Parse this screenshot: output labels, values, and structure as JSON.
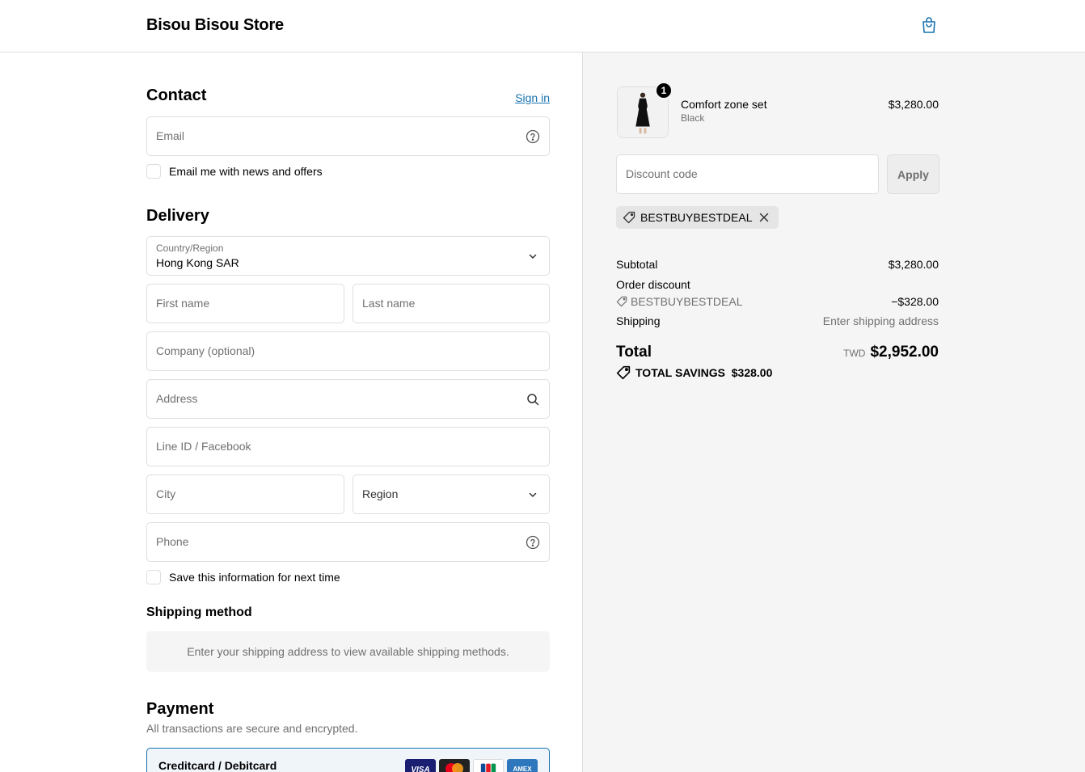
{
  "header": {
    "store_name": "Bisou Bisou Store",
    "cart_icon": "shopping-bag-icon"
  },
  "contact": {
    "title": "Contact",
    "sign_in": "Sign in",
    "email_placeholder": "Email",
    "news_checkbox": "Email me with news and offers"
  },
  "delivery": {
    "title": "Delivery",
    "country_label": "Country/Region",
    "country_value": "Hong Kong SAR",
    "first_name": "First name",
    "last_name": "Last name",
    "company": "Company (optional)",
    "address": "Address",
    "line_id": "Line ID / Facebook",
    "city": "City",
    "region": "Region",
    "phone": "Phone",
    "save_checkbox": "Save this information for next time"
  },
  "shipping": {
    "title": "Shipping method",
    "note": "Enter your shipping address to view available shipping methods."
  },
  "payment": {
    "title": "Payment",
    "subtitle": "All transactions are secure and encrypted.",
    "method": "Creditcard / Debitcard",
    "cards": [
      {
        "name": "VISA",
        "color": "#1a1f71"
      },
      {
        "name": "Mastercard",
        "color": "#222222"
      },
      {
        "name": "JCB",
        "color": "#ffffff"
      },
      {
        "name": "AMEX",
        "color": "#2e77bc"
      }
    ]
  },
  "summary": {
    "product": {
      "qty": "1",
      "name": "Comfort zone set",
      "variant": "Black",
      "price": "$3,280.00"
    },
    "discount_placeholder": "Discount code",
    "apply": "Apply",
    "applied_code": "BESTBUYBESTDEAL",
    "subtotal_label": "Subtotal",
    "subtotal": "$3,280.00",
    "order_discount_label": "Order discount",
    "discount_code": "BESTBUYBESTDEAL",
    "discount_amount": "−$328.00",
    "shipping_label": "Shipping",
    "shipping_value": "Enter shipping address",
    "total_label": "Total",
    "currency": "TWD",
    "total": "$2,952.00",
    "savings": "TOTAL SAVINGS  $328.00"
  },
  "colors": {
    "accent": "#1773b0",
    "border": "#dedede",
    "muted": "#707070",
    "summary_bg": "#f5f5f5"
  }
}
